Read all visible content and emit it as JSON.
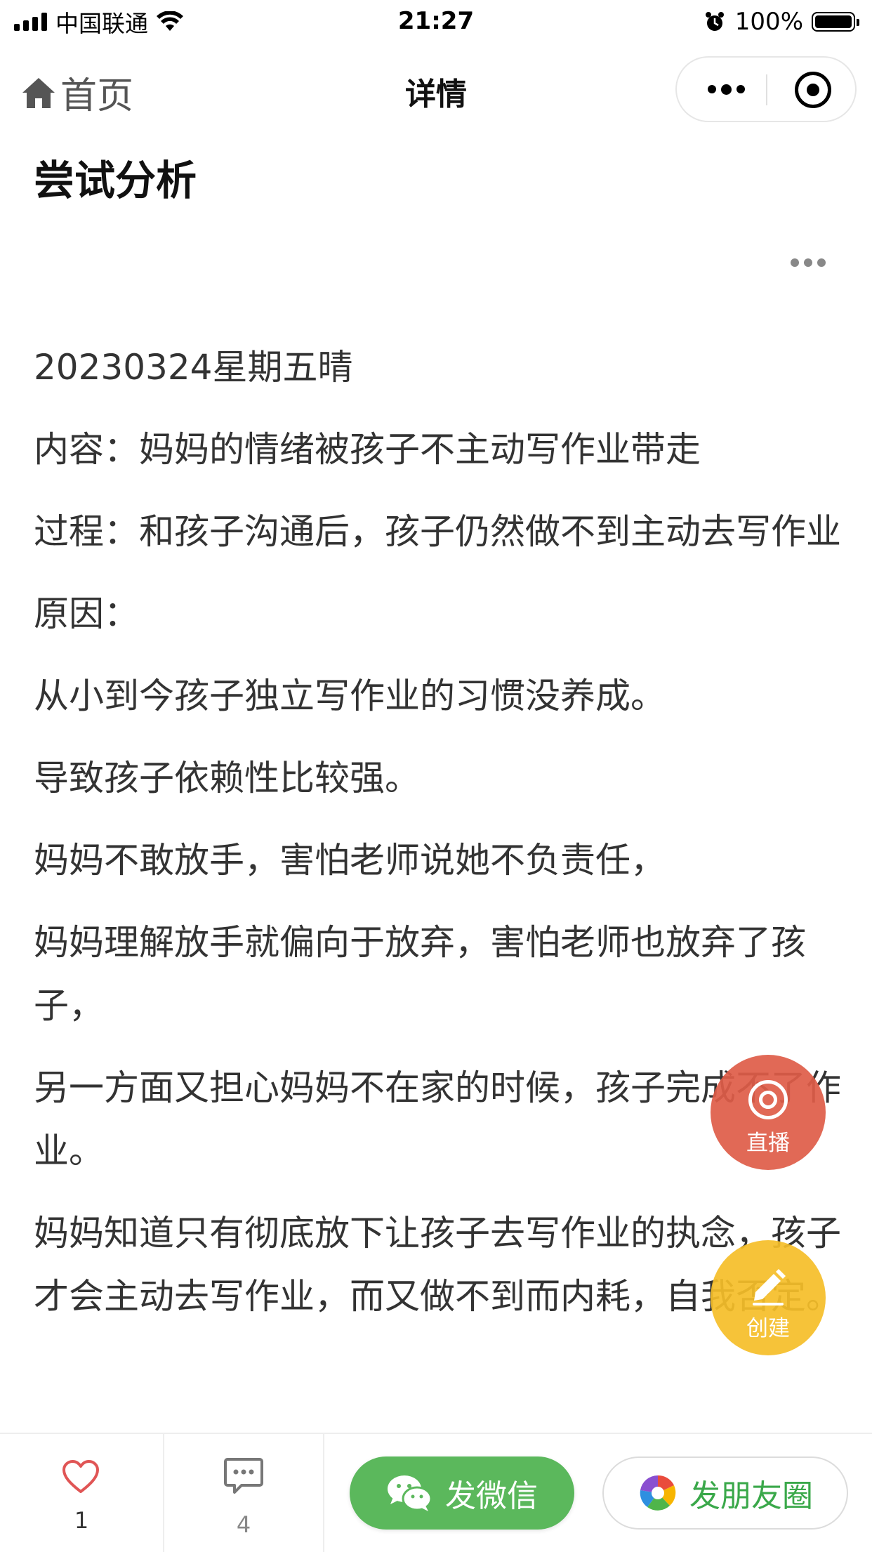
{
  "status_bar": {
    "carrier": "中国联通",
    "time": "21:27",
    "battery_text": "100%"
  },
  "navbar": {
    "home_label": "首页",
    "title": "详情"
  },
  "article": {
    "title": "尝试分析",
    "paragraphs": [
      "20230324星期五晴",
      "内容：妈妈的情绪被孩子不主动写作业带走",
      "过程：和孩子沟通后，孩子仍然做不到主动去写作业",
      "原因：",
      "从小到今孩子独立写作业的习惯没养成。",
      "导致孩子依赖性比较强。",
      "妈妈不敢放手，害怕老师说她不负责任，",
      "妈妈理解放手就偏向于放弃，害怕老师也放弃了孩子，",
      "另一方面又担心妈妈不在家的时候，孩子完成不了作业。",
      "妈妈知道只有彻底放下让孩子去写作业的执念，孩子才会主动去写作业，而又做不到而内耗，自我否定。"
    ]
  },
  "fab": {
    "live_label": "直播",
    "create_label": "创建",
    "live_color": "#de5c48",
    "create_color": "#f5be28"
  },
  "bottom_bar": {
    "like_count": "1",
    "comment_count": "4",
    "wechat_label": "发微信",
    "moments_label": "发朋友圈",
    "accent_green": "#5bb85c"
  },
  "icons": [
    "signal-icon",
    "wifi-icon",
    "alarm-icon",
    "battery-icon",
    "home-icon",
    "more-icon",
    "target-icon",
    "heart-icon",
    "comment-icon",
    "wechat-icon",
    "moments-icon",
    "live-icon",
    "pencil-icon"
  ]
}
